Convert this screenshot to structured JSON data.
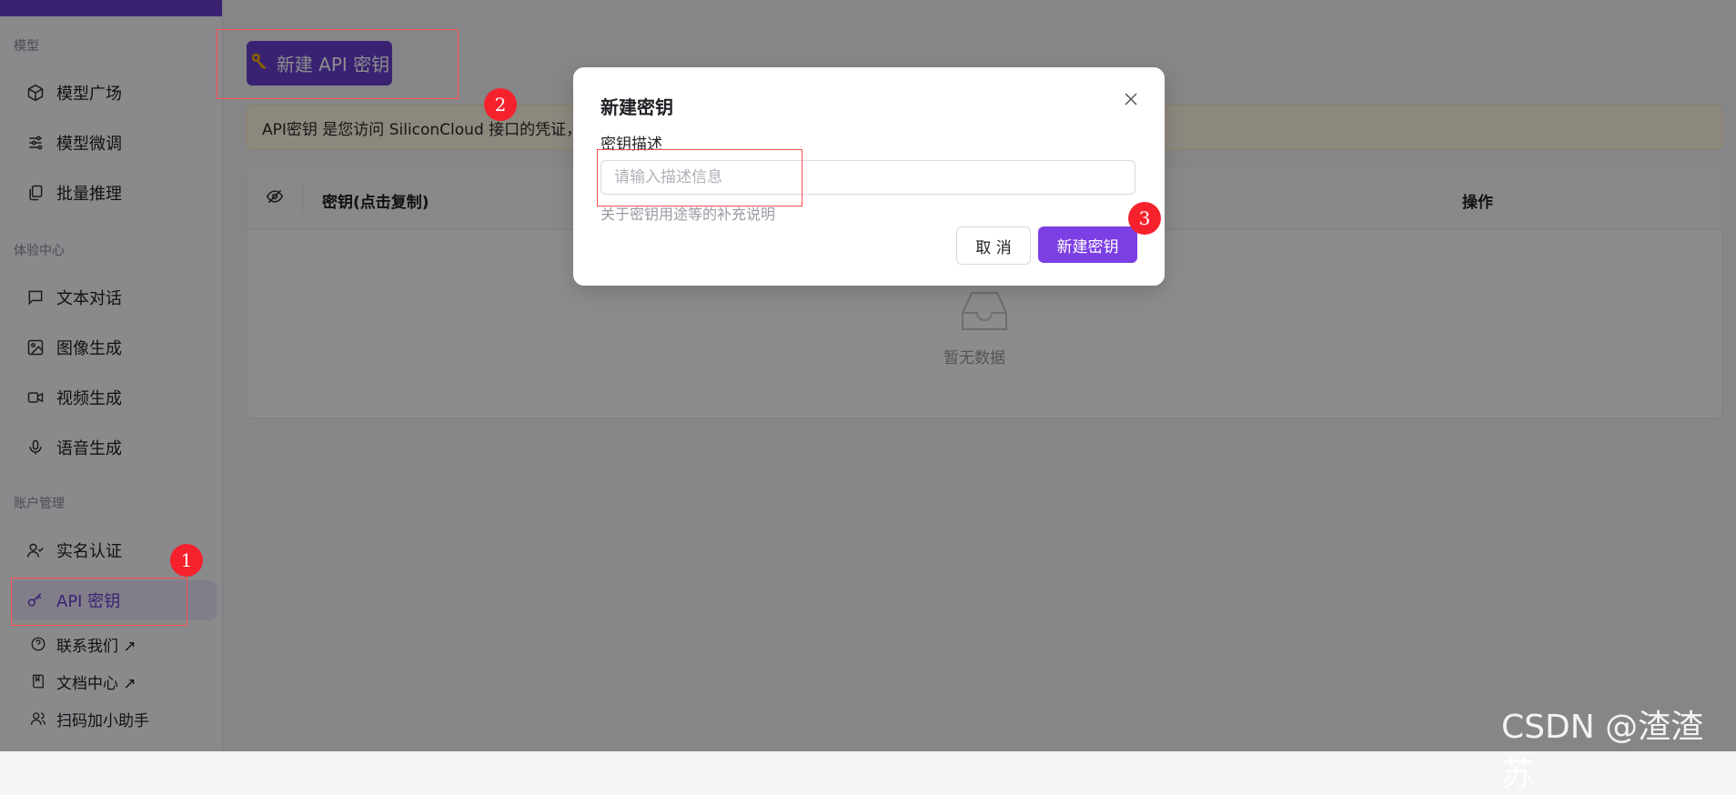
{
  "sidebar": {
    "section_model": "模型",
    "items_model": [
      {
        "label": "模型广场",
        "icon": "cube-icon"
      },
      {
        "label": "模型微调",
        "icon": "sliders-icon"
      },
      {
        "label": "批量推理",
        "icon": "layers-icon"
      }
    ],
    "section_experience": "体验中心",
    "items_experience": [
      {
        "label": "文本对话",
        "icon": "chat-icon"
      },
      {
        "label": "图像生成",
        "icon": "image-icon"
      },
      {
        "label": "视频生成",
        "icon": "video-icon"
      },
      {
        "label": "语音生成",
        "icon": "mic-icon"
      }
    ],
    "section_account": "账户管理",
    "items_account": [
      {
        "label": "实名认证",
        "icon": "user-check-icon"
      },
      {
        "label": "API 密钥",
        "icon": "key-icon",
        "active": true
      }
    ],
    "items_footer": [
      {
        "label": "联系我们 ↗",
        "icon": "help-circle-icon"
      },
      {
        "label": "文档中心 ↗",
        "icon": "book-icon"
      },
      {
        "label": "扫码加小助手",
        "icon": "users-icon"
      }
    ]
  },
  "main": {
    "new_key_button": "新建 API 密钥",
    "info_text": "API密钥 是您访问 SiliconCloud 接口的凭证，",
    "table": {
      "col_key": "密钥(点击复制)",
      "col_ops": "操作",
      "empty_text": "暂无数据"
    }
  },
  "modal": {
    "title": "新建密钥",
    "field_label": "密钥描述",
    "field_placeholder": "请输入描述信息",
    "field_value": "",
    "field_help": "关于密钥用途等的补充说明",
    "cancel": "取 消",
    "confirm": "新建密钥"
  },
  "annotations": {
    "badge_1": "1",
    "badge_2": "2",
    "badge_3": "3"
  },
  "watermark": "CSDN @渣渣苏",
  "colors": {
    "accent": "#6b3fd1",
    "confirm": "#7b3fe4",
    "annotation": "#f5222d"
  }
}
